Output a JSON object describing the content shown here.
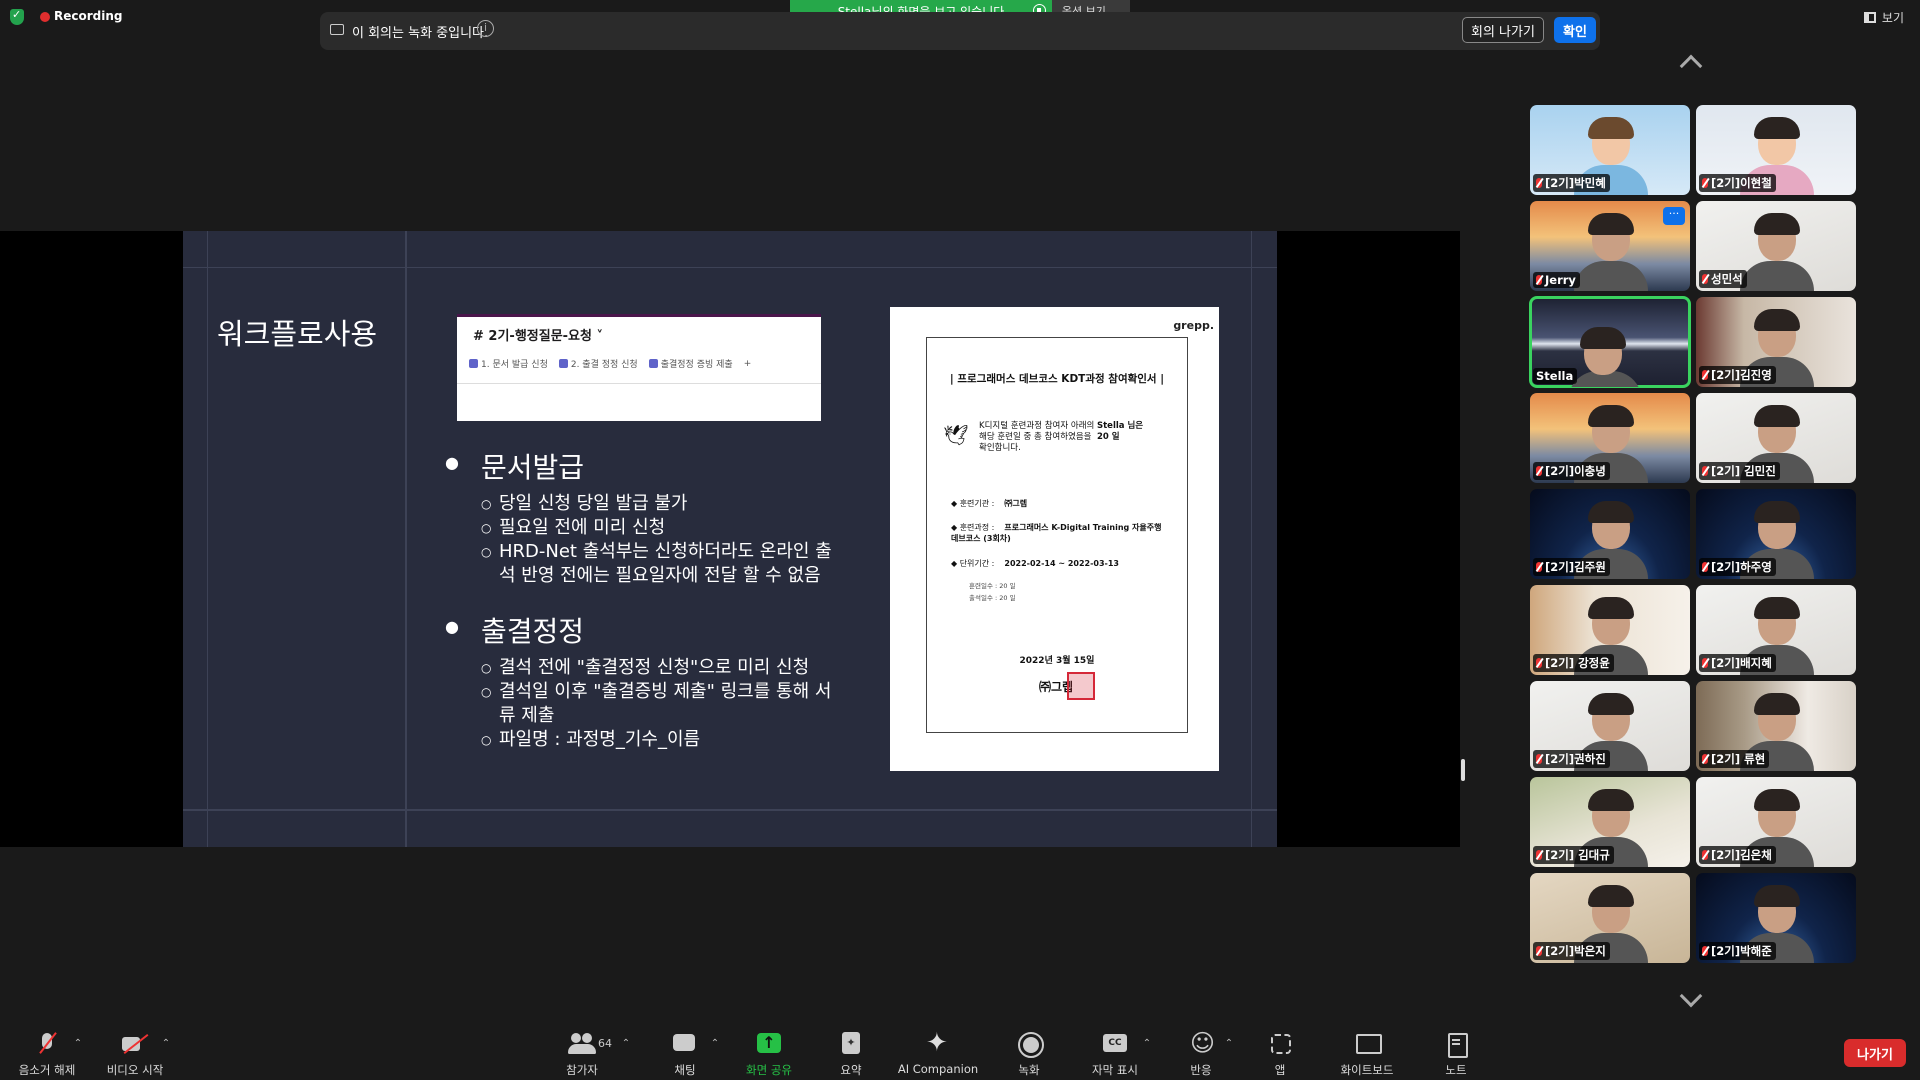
{
  "topbar": {
    "recording_label": "Recording",
    "view_label": "보기",
    "share_banner": "Stella님의 화면을 보고 있습니다",
    "view_options": "옵션 보기"
  },
  "record_notice": {
    "text": "이 회의는 녹화 중입니다.",
    "info": "i",
    "leave_meeting": "회의 나가기",
    "confirm": "확인"
  },
  "slide": {
    "title": "워크플로사용",
    "channel": {
      "name": "# 2기-행정질문-요청 ˅",
      "bookmarks": [
        "1. 문서 발급 신청",
        "2. 출결 정정 신청",
        "출결정정 증빙 제출",
        "+"
      ]
    },
    "sections": [
      {
        "heading": "문서발급",
        "items": [
          "당일 신청 당일 발급 불가",
          "필요일 전에 미리 신청",
          "HRD-Net 출석부는 신청하더라도 온라인 출석 반영 전에는 필요일자에 전달 할 수 없음"
        ]
      },
      {
        "heading": "출결정정",
        "items": [
          "결석 전에 \"출결정정 신청\"으로 미리 신청",
          "결석일 이후 \"출결증빙 제출\" 링크를 통해 서류 제출",
          "파일명 : 과정명_기수_이름"
        ]
      }
    ],
    "certificate": {
      "logo": "grepp.",
      "title": "| 프로그래머스 데브코스 KDT과정 참여확인서 |",
      "body": "K디지털 훈련과정 참여자 아래의 해당 훈련일 중 총 참여하였음을 확인합니다.",
      "name_line": "Stella 님은",
      "days_line": "20 일",
      "institution_label": "◆ 훈련기관 :",
      "institution": "㈜그렙",
      "course_label": "◆ 훈련과정 :",
      "course": "프로그래머스 K-Digital Training 자율주행 데브코스 (3회차)",
      "period_label": "◆ 단위기간 :",
      "period": "2022-02-14 ~ 2022-03-13",
      "training_days": "훈련일수 :    20    일",
      "attend_days": "출석일수 :    20    일",
      "date": "2022년 3월 15일",
      "signer": "㈜그렙"
    }
  },
  "participants": [
    {
      "name": "[2기]박민혜",
      "bg": "bg-avatar1",
      "avatar": true
    },
    {
      "name": "[2기]이현철",
      "bg": "bg-avatar2",
      "avatar": true
    },
    {
      "name": "Jerry",
      "bg": "bg-bridge",
      "more": "···"
    },
    {
      "name": "성민석",
      "bg": "bg-white"
    },
    {
      "name": "Stella",
      "bg": "bg-stella",
      "active": true
    },
    {
      "name": "[2기]김진영",
      "bg": "bg-shelf"
    },
    {
      "name": "[2기]이충녕",
      "bg": "bg-bridge"
    },
    {
      "name": "[2기] 김민진",
      "bg": "bg-white"
    },
    {
      "name": "[2기]김주원",
      "bg": "bg-space"
    },
    {
      "name": "[2기]하주영",
      "bg": "bg-space"
    },
    {
      "name": "[2기] 강정윤",
      "bg": "bg-sign"
    },
    {
      "name": "[2기]배지혜",
      "bg": "bg-white"
    },
    {
      "name": "[2기]권하진",
      "bg": "bg-white"
    },
    {
      "name": "[2기] 류현",
      "bg": "bg-wood"
    },
    {
      "name": "[2기] 김대규",
      "bg": "bg-green"
    },
    {
      "name": "[2기]김은채",
      "bg": "bg-white"
    },
    {
      "name": "[2기]박은지",
      "bg": "bg-warm"
    },
    {
      "name": "[2기]박해준",
      "bg": "bg-space"
    }
  ],
  "toolbar": {
    "unmute": "음소거 해제",
    "start_video": "비디오 시작",
    "participants": "참가자",
    "participant_count": "64",
    "chat": "채팅",
    "share_screen": "화면 공유",
    "summary": "요약",
    "ai_companion": "AI Companion",
    "record": "녹화",
    "captions": "자막 표시",
    "reactions": "반응",
    "apps": "앱",
    "whiteboard": "화이트보드",
    "notes": "노트",
    "leave": "나가기"
  },
  "colors": {
    "share_green": "#26a84a",
    "confirm_blue": "#0e71eb",
    "leave_red": "#d92c2c",
    "active_speaker": "#3ad35f",
    "slide_bg": "#282c3d"
  }
}
